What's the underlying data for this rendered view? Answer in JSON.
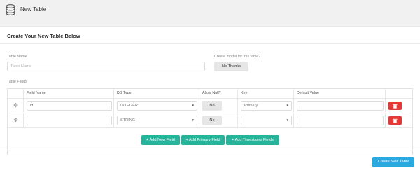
{
  "header": {
    "icon": "database-icon",
    "title": "New Table"
  },
  "card": {
    "title": "Create Your New Table Below"
  },
  "form": {
    "table_name_label": "Table Name",
    "table_name_placeholder": "Table Name",
    "model_label": "Create model for this table?",
    "model_button": "No Thanks",
    "table_fields_label": "Table Fields"
  },
  "columns": [
    "Field Name",
    "DB Type",
    "Allow Null?",
    "Key",
    "Default Value"
  ],
  "rows": [
    {
      "field_name": "id",
      "db_type": "INTEGER",
      "allow_null": "No",
      "key": "Primary",
      "default_value": ""
    },
    {
      "field_name": "",
      "db_type": "STRING",
      "allow_null": "No",
      "key": "",
      "default_value": ""
    }
  ],
  "actions": {
    "add_new_field": "+ Add New Field",
    "add_primary_field": "+ Add Primary Field",
    "add_timestamp_fields": "+ Add Timestamp Fields",
    "create_new_table": "Create New Table"
  },
  "colors": {
    "teal": "#26b59a",
    "blue": "#2aa8e0",
    "red": "#e53935"
  }
}
